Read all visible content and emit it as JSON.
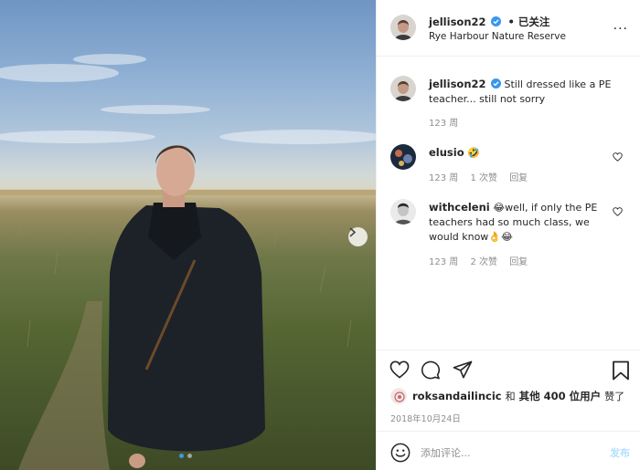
{
  "post": {
    "username": "jellison22",
    "follow_label": "• 已关注",
    "location": "Rye Harbour Nature Reserve",
    "more_label": "···"
  },
  "caption": {
    "username": "jellison22",
    "text": "Still dressed like a PE teacher... still not sorry",
    "age": "123 周"
  },
  "comments": [
    {
      "username": "elusio",
      "text": "🤣",
      "age": "123 周",
      "likes": "1 次赞",
      "reply": "回复"
    },
    {
      "username": "withceleni",
      "text": "😂well, if only the PE teachers had so much class, we would know👌😂",
      "age": "123 周",
      "likes": "2 次赞",
      "reply": "回复"
    }
  ],
  "likes": {
    "username": "roksandailincic",
    "connector": "和",
    "others": "其他 400 位用户",
    "suffix": "赞了"
  },
  "date": "2018年10月24日",
  "comment_box": {
    "placeholder": "添加评论...",
    "post_label": "发布"
  },
  "carousel": {
    "current": 1,
    "total": 2
  },
  "colors": {
    "accent": "#3897f0",
    "verified": "#3897f0",
    "post_disabled": "#b2dffc"
  }
}
